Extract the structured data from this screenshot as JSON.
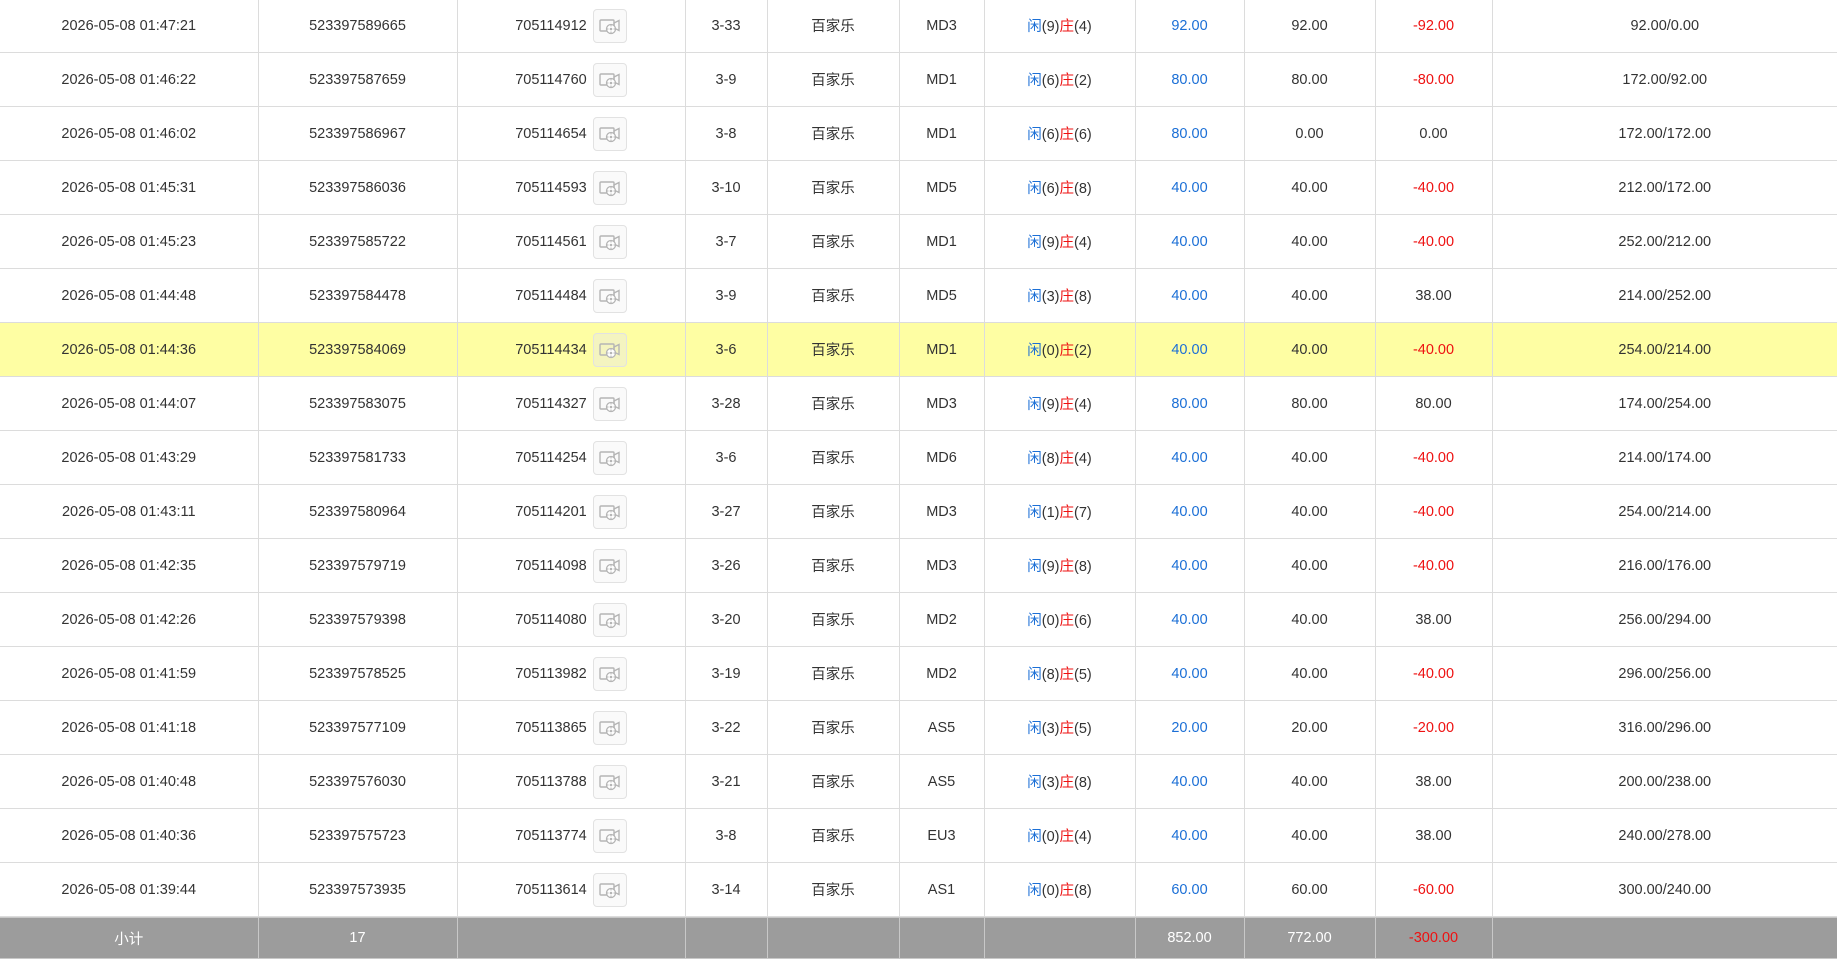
{
  "labels": {
    "player": "闲",
    "banker": "庄"
  },
  "rows": [
    {
      "time": "2026-05-08 01:47:21",
      "order_no": "523397589665",
      "round_no": "705114912",
      "shoe_hand": "3-33",
      "game": "百家乐",
      "table": "MD3",
      "player_pts": "9",
      "banker_pts": "4",
      "bet": "92.00",
      "valid_bet": "92.00",
      "win_loss": "-92.00",
      "balance": "92.00/0.00"
    },
    {
      "time": "2026-05-08 01:46:22",
      "order_no": "523397587659",
      "round_no": "705114760",
      "shoe_hand": "3-9",
      "game": "百家乐",
      "table": "MD1",
      "player_pts": "6",
      "banker_pts": "2",
      "bet": "80.00",
      "valid_bet": "80.00",
      "win_loss": "-80.00",
      "balance": "172.00/92.00"
    },
    {
      "time": "2026-05-08 01:46:02",
      "order_no": "523397586967",
      "round_no": "705114654",
      "shoe_hand": "3-8",
      "game": "百家乐",
      "table": "MD1",
      "player_pts": "6",
      "banker_pts": "6",
      "bet": "80.00",
      "valid_bet": "0.00",
      "win_loss": "0.00",
      "balance": "172.00/172.00"
    },
    {
      "time": "2026-05-08 01:45:31",
      "order_no": "523397586036",
      "round_no": "705114593",
      "shoe_hand": "3-10",
      "game": "百家乐",
      "table": "MD5",
      "player_pts": "6",
      "banker_pts": "8",
      "bet": "40.00",
      "valid_bet": "40.00",
      "win_loss": "-40.00",
      "balance": "212.00/172.00"
    },
    {
      "time": "2026-05-08 01:45:23",
      "order_no": "523397585722",
      "round_no": "705114561",
      "shoe_hand": "3-7",
      "game": "百家乐",
      "table": "MD1",
      "player_pts": "9",
      "banker_pts": "4",
      "bet": "40.00",
      "valid_bet": "40.00",
      "win_loss": "-40.00",
      "balance": "252.00/212.00"
    },
    {
      "time": "2026-05-08 01:44:48",
      "order_no": "523397584478",
      "round_no": "705114484",
      "shoe_hand": "3-9",
      "game": "百家乐",
      "table": "MD5",
      "player_pts": "3",
      "banker_pts": "8",
      "bet": "40.00",
      "valid_bet": "40.00",
      "win_loss": "38.00",
      "balance": "214.00/252.00"
    },
    {
      "time": "2026-05-08 01:44:36",
      "order_no": "523397584069",
      "round_no": "705114434",
      "shoe_hand": "3-6",
      "game": "百家乐",
      "table": "MD1",
      "player_pts": "0",
      "banker_pts": "2",
      "bet": "40.00",
      "valid_bet": "40.00",
      "win_loss": "-40.00",
      "balance": "254.00/214.00",
      "highlight": true
    },
    {
      "time": "2026-05-08 01:44:07",
      "order_no": "523397583075",
      "round_no": "705114327",
      "shoe_hand": "3-28",
      "game": "百家乐",
      "table": "MD3",
      "player_pts": "9",
      "banker_pts": "4",
      "bet": "80.00",
      "valid_bet": "80.00",
      "win_loss": "80.00",
      "balance": "174.00/254.00"
    },
    {
      "time": "2026-05-08 01:43:29",
      "order_no": "523397581733",
      "round_no": "705114254",
      "shoe_hand": "3-6",
      "game": "百家乐",
      "table": "MD6",
      "player_pts": "8",
      "banker_pts": "4",
      "bet": "40.00",
      "valid_bet": "40.00",
      "win_loss": "-40.00",
      "balance": "214.00/174.00"
    },
    {
      "time": "2026-05-08 01:43:11",
      "order_no": "523397580964",
      "round_no": "705114201",
      "shoe_hand": "3-27",
      "game": "百家乐",
      "table": "MD3",
      "player_pts": "1",
      "banker_pts": "7",
      "bet": "40.00",
      "valid_bet": "40.00",
      "win_loss": "-40.00",
      "balance": "254.00/214.00"
    },
    {
      "time": "2026-05-08 01:42:35",
      "order_no": "523397579719",
      "round_no": "705114098",
      "shoe_hand": "3-26",
      "game": "百家乐",
      "table": "MD3",
      "player_pts": "9",
      "banker_pts": "8",
      "bet": "40.00",
      "valid_bet": "40.00",
      "win_loss": "-40.00",
      "balance": "216.00/176.00"
    },
    {
      "time": "2026-05-08 01:42:26",
      "order_no": "523397579398",
      "round_no": "705114080",
      "shoe_hand": "3-20",
      "game": "百家乐",
      "table": "MD2",
      "player_pts": "0",
      "banker_pts": "6",
      "bet": "40.00",
      "valid_bet": "40.00",
      "win_loss": "38.00",
      "balance": "256.00/294.00"
    },
    {
      "time": "2026-05-08 01:41:59",
      "order_no": "523397578525",
      "round_no": "705113982",
      "shoe_hand": "3-19",
      "game": "百家乐",
      "table": "MD2",
      "player_pts": "8",
      "banker_pts": "5",
      "bet": "40.00",
      "valid_bet": "40.00",
      "win_loss": "-40.00",
      "balance": "296.00/256.00"
    },
    {
      "time": "2026-05-08 01:41:18",
      "order_no": "523397577109",
      "round_no": "705113865",
      "shoe_hand": "3-22",
      "game": "百家乐",
      "table": "AS5",
      "player_pts": "3",
      "banker_pts": "5",
      "bet": "20.00",
      "valid_bet": "20.00",
      "win_loss": "-20.00",
      "balance": "316.00/296.00"
    },
    {
      "time": "2026-05-08 01:40:48",
      "order_no": "523397576030",
      "round_no": "705113788",
      "shoe_hand": "3-21",
      "game": "百家乐",
      "table": "AS5",
      "player_pts": "3",
      "banker_pts": "8",
      "bet": "40.00",
      "valid_bet": "40.00",
      "win_loss": "38.00",
      "balance": "200.00/238.00"
    },
    {
      "time": "2026-05-08 01:40:36",
      "order_no": "523397575723",
      "round_no": "705113774",
      "shoe_hand": "3-8",
      "game": "百家乐",
      "table": "EU3",
      "player_pts": "0",
      "banker_pts": "4",
      "bet": "40.00",
      "valid_bet": "40.00",
      "win_loss": "38.00",
      "balance": "240.00/278.00"
    },
    {
      "time": "2026-05-08 01:39:44",
      "order_no": "523397573935",
      "round_no": "705113614",
      "shoe_hand": "3-14",
      "game": "百家乐",
      "table": "AS1",
      "player_pts": "0",
      "banker_pts": "8",
      "bet": "60.00",
      "valid_bet": "60.00",
      "win_loss": "-60.00",
      "balance": "300.00/240.00"
    }
  ],
  "subtotal": {
    "label": "小计",
    "count": "17",
    "bet": "852.00",
    "valid_bet": "772.00",
    "win_loss": "-300.00"
  },
  "colors": {
    "bet_blue": "#1b6fd6",
    "negative_red": "#ee1111",
    "highlight_yellow": "#fefea3",
    "subtotal_gray": "#9c9c9c"
  },
  "icons": {
    "replay": "replay-video-icon"
  }
}
